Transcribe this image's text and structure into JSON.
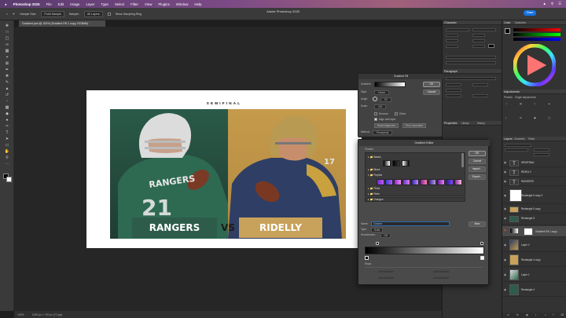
{
  "menubar": {
    "apple": "",
    "app_name": "Photoshop 2025",
    "items": [
      "File",
      "Edit",
      "Image",
      "Layer",
      "Type",
      "Select",
      "Filter",
      "View",
      "Plugins",
      "Window",
      "Help"
    ]
  },
  "window_title": "Adobe Photoshop 2025",
  "options": {
    "sample_label": "Sample Size:",
    "sample_value": "Point Sample",
    "sample2_label": "Sample:",
    "sample2_value": "All Layers",
    "ring_label": "Show Sampling Ring",
    "share_label": "Share"
  },
  "document_tab": "Gradient.psd @ 100% (Gradient Fill 1 copy, RGB/8#)",
  "artboard": {
    "semifinal": "SEMIFINAL",
    "team_left": "RANGERS",
    "vs": "VS",
    "team_right": "RIDELLY",
    "jersey_left_number": "21",
    "jersey_left_word": "RANGERS",
    "jersey_right_number": "17"
  },
  "status": {
    "zoom": "100%",
    "doc_size": "1200 px × 720 px (72 ppi)"
  },
  "panels": {
    "character_title": "Character",
    "paragraph_title": "Paragraph",
    "properties_title": "Properties",
    "library_title": "Library",
    "history_title": "History",
    "color_title": "Color",
    "swatches_title": "Swatches",
    "adjustments_title": "Adjustments",
    "presets_tab": "Presets",
    "single_adjust_tab": "Single adjustments",
    "adjust_items": [
      "Brightness/Contrast",
      "Levels",
      "Curves",
      "Exposure",
      "Hue/Saturation",
      "Color Balance",
      "Black & White",
      "Photo Filter"
    ],
    "layers_tab": "Layers",
    "channels_tab": "Channels",
    "paths_tab": "Paths"
  },
  "layers": [
    {
      "name": "SEMIFINAL",
      "type": "text"
    },
    {
      "name": "RIDELLY",
      "type": "text"
    },
    {
      "name": "RANGERS",
      "type": "text"
    },
    {
      "name": "Rectangle 5 copy 2",
      "type": "shape"
    },
    {
      "name": "Rectangle 5 copy",
      "type": "shape"
    },
    {
      "name": "Rectangle 5",
      "type": "shape"
    },
    {
      "name": "Gradient Fill 1 copy",
      "type": "fill",
      "selected": true
    },
    {
      "name": "Layer 2",
      "type": "image"
    },
    {
      "name": "Rectangle 4 copy",
      "type": "shape"
    },
    {
      "name": "Layer 1",
      "type": "image"
    },
    {
      "name": "Rectangle 4",
      "type": "shape"
    }
  ],
  "gradient_fill": {
    "title": "Gradient Fill",
    "gradient_label": "Gradient:",
    "style_label": "Style:",
    "style_value": "Linear",
    "angle_label": "Angle:",
    "angle_value": "90",
    "scale_label": "Scale:",
    "scale_value": "100",
    "reverse_label": "Reverse",
    "dither_label": "Dither",
    "align_label": "Align with layer",
    "reset_label": "Reset Alignment",
    "fit_label": "Fit to document",
    "method_label": "Method:",
    "method_value": "Perceptual",
    "ok": "OK",
    "cancel": "Cancel"
  },
  "gradient_editor": {
    "title": "Gradient Editor",
    "presets_label": "Presets",
    "folders": [
      "Basics",
      "Blues",
      "Purples",
      "Pinks",
      "Reds",
      "Oranges"
    ],
    "ok": "OK",
    "cancel": "Cancel",
    "import": "Import...",
    "export": "Export...",
    "name_label": "Name:",
    "name_value": "Custom",
    "new_label": "New",
    "type_label": "Type:",
    "type_value": "Solid",
    "smooth_label": "Smoothness:",
    "smooth_value": "100",
    "stops_label": "Stops"
  },
  "colors": {
    "accent": "#1473e6",
    "green_team": "#2d5c4b",
    "gold_team": "#c8a15a"
  }
}
